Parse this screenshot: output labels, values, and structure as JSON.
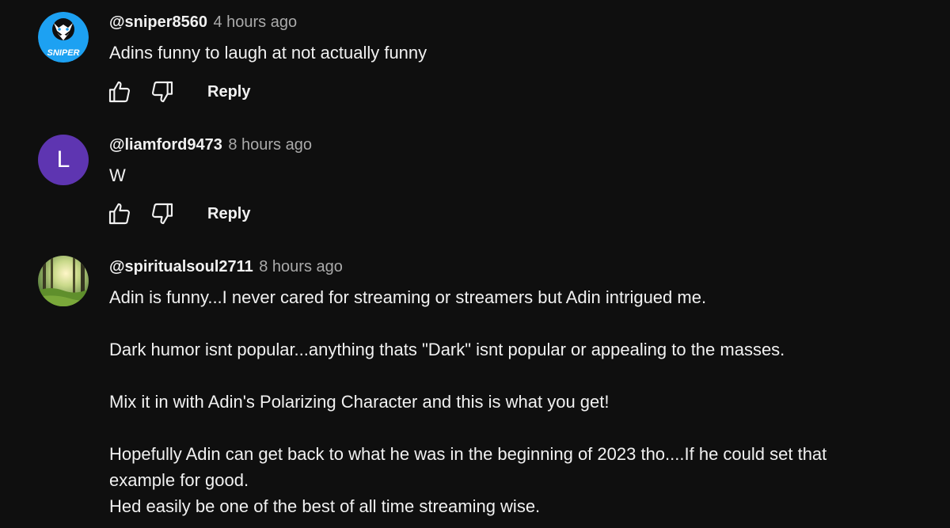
{
  "comments": [
    {
      "author": "@sniper8560",
      "time": "4 hours ago",
      "avatar": {
        "type": "logo",
        "text": "SNIPER",
        "bg": "#1da1f2"
      },
      "paragraphs": [
        "Adins funny to laugh at not actually funny"
      ],
      "reply_label": "Reply"
    },
    {
      "author": "@liamford9473",
      "time": "8 hours ago",
      "avatar": {
        "type": "letter",
        "letter": "L",
        "bg": "#5e35b1"
      },
      "paragraphs": [
        "W"
      ],
      "reply_label": "Reply"
    },
    {
      "author": "@spiritualsoul2711",
      "time": "8 hours ago",
      "avatar": {
        "type": "photo",
        "subject": "forest-sunlight"
      },
      "paragraphs": [
        "Adin is funny...I never cared for streaming or streamers but Adin intrigued me.",
        "Dark humor isnt popular...anything thats \"Dark\" isnt popular or appealing to the masses.",
        "Mix it in with Adin's Polarizing Character and this is what you get!",
        "Hopefully Adin can get back to what he was in the beginning of 2023 tho....If he could set that example for good.",
        "Hed easily be one of the best of all time streaming wise."
      ]
    }
  ],
  "icons": {
    "like": "thumbs-up-icon",
    "dislike": "thumbs-down-icon"
  },
  "colors": {
    "background": "#0f0f0f",
    "text": "#f1f1f1",
    "secondary_text": "#aaaaaa"
  }
}
